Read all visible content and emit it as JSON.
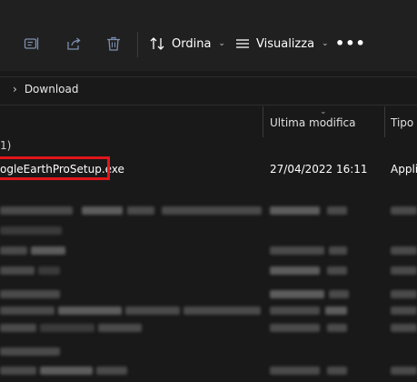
{
  "toolbar": {
    "sort_label": "Ordina",
    "view_label": "Visualizza",
    "more_label": "•••"
  },
  "breadcrumb": {
    "separator": "›",
    "current": "Download"
  },
  "columns": {
    "modified": "Ultima modifica",
    "type": "Tipo"
  },
  "group": {
    "label": "1)"
  },
  "files": [
    {
      "name": "ogleEarthProSetup.exe",
      "modified": "27/04/2022 16:11",
      "type": "Applic"
    }
  ],
  "colors": {
    "highlight_border": "#e0161b",
    "background": "#191919",
    "toolbar": "#202020"
  },
  "icons": [
    "rename-icon",
    "share-icon",
    "delete-icon",
    "sort-icon",
    "view-icon",
    "more-icon"
  ]
}
